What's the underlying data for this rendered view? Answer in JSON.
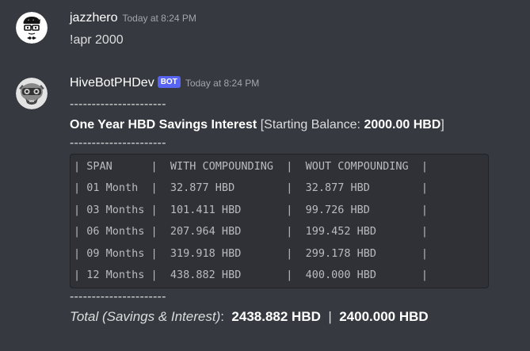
{
  "messages": [
    {
      "username": "jazzhero",
      "timestamp": "Today at 8:24 PM",
      "text": "!apr 2000"
    },
    {
      "username": "HiveBotPHDev",
      "bot_tag": "BOT",
      "timestamp": "Today at 8:24 PM",
      "divider": "----------------------",
      "title_bold": "One Year HBD Savings Interest",
      "title_open": " [Starting Balance: ",
      "title_balance": "2000.00 HBD",
      "title_close": "]",
      "table_rows": [
        "| SPAN      |  WITH COMPOUNDING  |  WOUT COMPOUNDING  |",
        "| 01 Month  |  32.877 HBD        |  32.877 HBD        |",
        "| 03 Months |  101.411 HBD       |  99.726 HBD        |",
        "| 06 Months |  207.964 HBD       |  199.452 HBD       |",
        "| 09 Months |  319.918 HBD       |  299.178 HBD       |",
        "| 12 Months |  438.882 HBD       |  400.000 HBD       |"
      ],
      "total_label": "Total (Savings & Interest)",
      "total_colon": ":  ",
      "total_with": "2438.882 HBD",
      "total_sep": "  |  ",
      "total_wout": "2400.000 HBD"
    }
  ],
  "colors": {
    "background": "#36393f",
    "code_background": "#2f3136",
    "bot_tag": "#5865f2",
    "username": "#ffffff",
    "timestamp": "#a3a6aa",
    "text": "#dcddde"
  }
}
